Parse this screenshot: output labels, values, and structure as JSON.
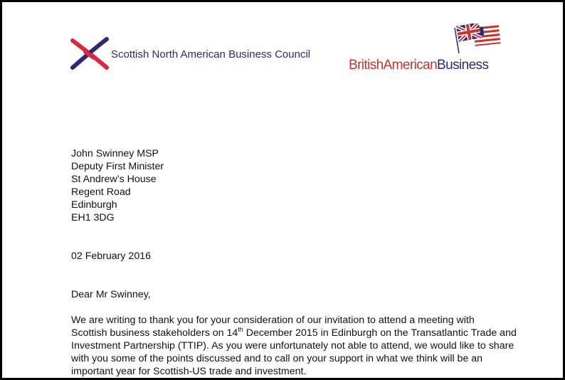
{
  "header": {
    "left_logo": {
      "icon": "x-cross-logo-icon",
      "name": "Scottish North American Business Council",
      "colors": {
        "red": "#d9283f",
        "navy": "#2b2a73"
      }
    },
    "right_logo": {
      "icon": "union-jack-us-flag-icon",
      "word_british": "British",
      "word_american": "American",
      "word_business": "Business",
      "colors": {
        "red": "#c9312f",
        "navy": "#2b2a73"
      }
    }
  },
  "recipient": {
    "lines": [
      "John Swinney MSP",
      "Deputy First Minister",
      "St Andrew’s House",
      "Regent Road",
      "Edinburgh",
      "EH1 3DG"
    ]
  },
  "date": "02 February 2016",
  "salutation": "Dear Mr Swinney,",
  "body": {
    "line1": "We are writing to thank you for your consideration of our invitation to attend a meeting with",
    "line2_before": "Scottish business stakeholders on 14",
    "line2_sup": "th",
    "line2_after": " December 2015 in Edinburgh on the Transatlantic Trade and",
    "line3": "Investment Partnership (TTIP). As you were unfortunately not able to attend, we would like to share",
    "line4": "with you some of the points discussed and to call on your support in what we think will be an",
    "line5": "important year for Scottish-US trade and investment."
  }
}
